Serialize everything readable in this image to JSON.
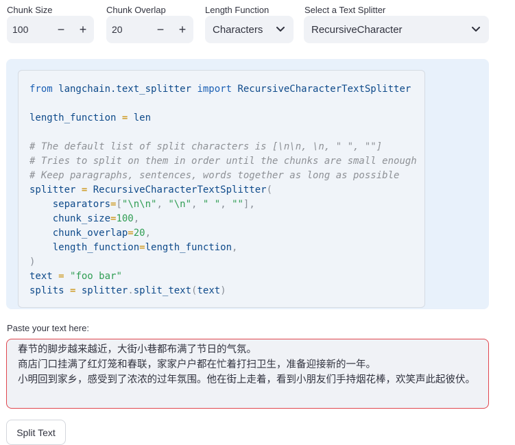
{
  "controls": {
    "chunk_size": {
      "label": "Chunk Size",
      "value": "100",
      "minus": "−",
      "plus": "+"
    },
    "chunk_overlap": {
      "label": "Chunk Overlap",
      "value": "20",
      "minus": "−",
      "plus": "+"
    },
    "length_function": {
      "label": "Length Function",
      "selected": "Characters"
    },
    "text_splitter": {
      "label": "Select a Text Splitter",
      "selected": "RecursiveCharacter"
    }
  },
  "code": {
    "l1_kw1": "from",
    "l1_mod": " langchain.text_splitter ",
    "l1_kw2": "import",
    "l1_cls": " RecursiveCharacterTextSplitter",
    "l3_name": "length_function",
    "l3_eq": " = ",
    "l3_val": "len",
    "c1": "# The default list of split characters is [\\n\\n, \\n, \" \", \"\"]",
    "c2": "# Tries to split on them in order until the chunks are small enough",
    "c3": "# Keep paragraphs, sentences, words together as long as possible",
    "s_name": "splitter",
    "s_eq": " = ",
    "s_cls": "RecursiveCharacterTextSplitter",
    "s_open": "(",
    "a1_name": "    separators",
    "a1_eq": "=",
    "a1_lb": "[",
    "a1_v1": "\"\\n\\n\"",
    "a1_c1": ", ",
    "a1_v2": "\"\\n\"",
    "a1_c2": ", ",
    "a1_v3": "\" \"",
    "a1_c3": ", ",
    "a1_v4": "\"\"",
    "a1_rb": "],",
    "a2_name": "    chunk_size",
    "a2_eq": "=",
    "a2_val": "100",
    "a2_c": ",",
    "a3_name": "    chunk_overlap",
    "a3_eq": "=",
    "a3_val": "20",
    "a3_c": ",",
    "a4_name": "    length_function",
    "a4_eq": "=",
    "a4_val": "length_function",
    "a4_c": ",",
    "close": ")",
    "t_name": "text",
    "t_eq": " = ",
    "t_val": "\"foo bar\"",
    "sp_name": "splits",
    "sp_eq": " = ",
    "sp_obj": "splitter",
    "sp_dot": ".",
    "sp_fn": "split_text",
    "sp_lp": "(",
    "sp_arg": "text",
    "sp_rp": ")"
  },
  "input": {
    "label": "Paste your text here:",
    "line1": "春节的脚步越来越近，大街小巷都布满了节日的气氛。",
    "line2": "",
    "line3": "商店门口挂满了红灯笼和春联，家家户户都在忙着打扫卫生，准备迎接新的一年。",
    "line4": "小明回到家乡，感受到了浓浓的过年氛围。他在街上走着，看到小朋友们手持烟花棒，欢笑声此起彼伏。"
  },
  "button": {
    "label": "Split Text"
  },
  "colors": {
    "error_border": "#e0464e",
    "code_bg": "#e8f1fb",
    "control_bg": "#f0f2f6"
  }
}
